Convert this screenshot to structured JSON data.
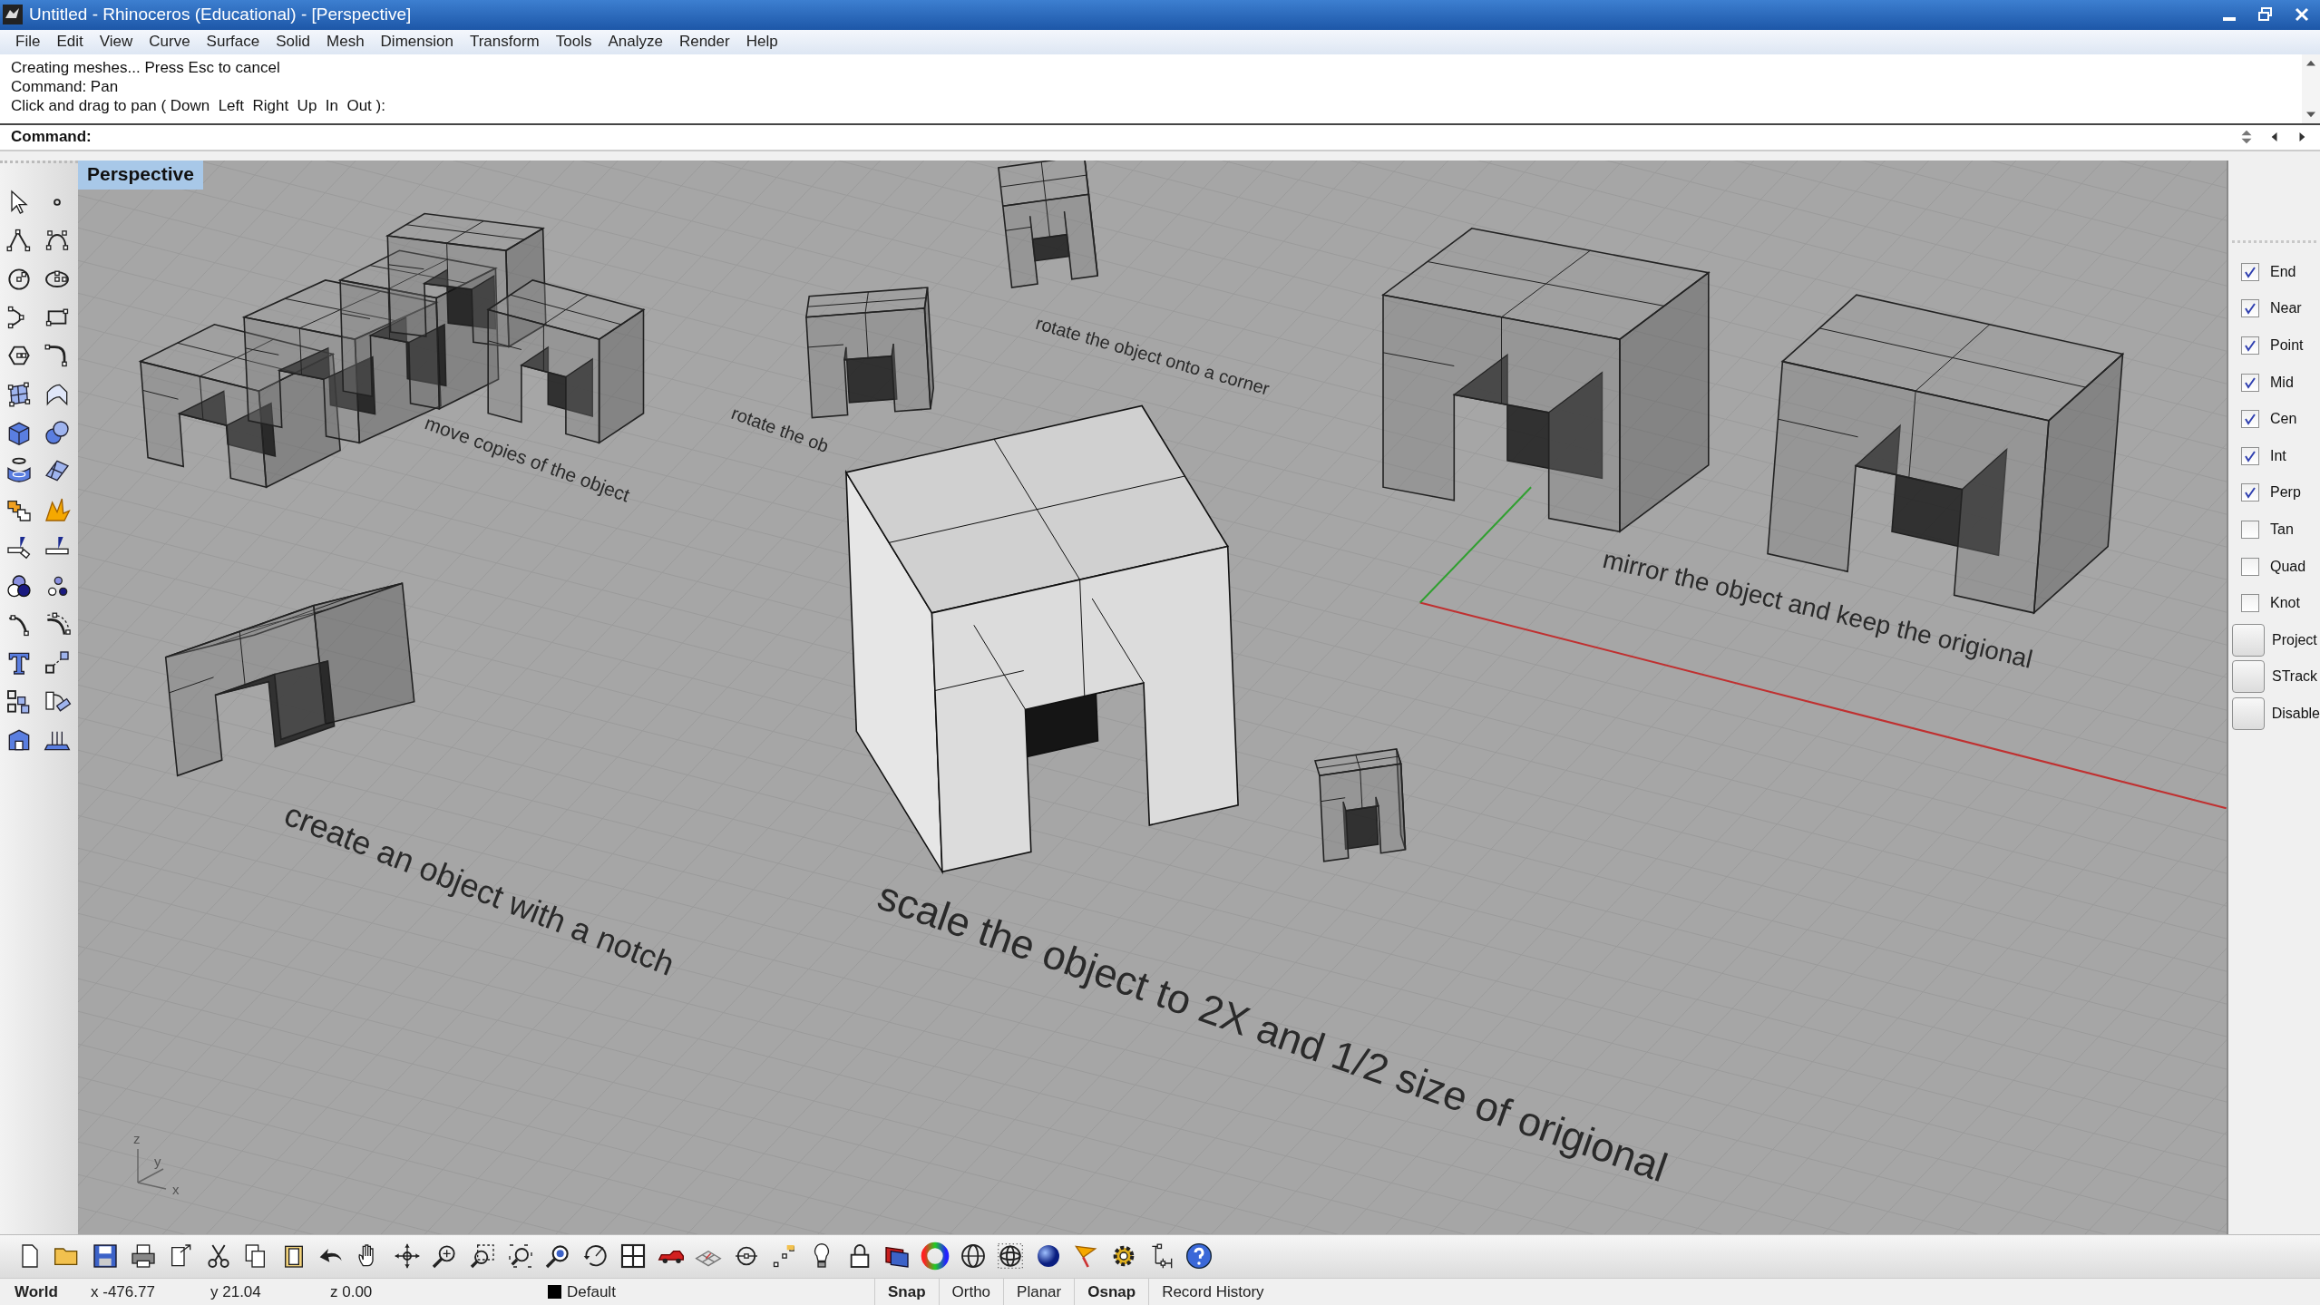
{
  "window": {
    "title": "Untitled - Rhinoceros (Educational) - [Perspective]"
  },
  "menu": [
    "File",
    "Edit",
    "View",
    "Curve",
    "Surface",
    "Solid",
    "Mesh",
    "Dimension",
    "Transform",
    "Tools",
    "Analyze",
    "Render",
    "Help"
  ],
  "command_history": [
    "Creating meshes... Press Esc to cancel",
    "Command: Pan",
    "Click and drag to pan ( Down  Left  Right  Up  In  Out ):"
  ],
  "command_prompt": {
    "label": "Command:"
  },
  "viewport": {
    "title": "Perspective",
    "annotations": [
      "move copies of the object",
      "rotate the object onto a corner",
      "rotate the ob",
      "mirror the object and keep the origional",
      "create an object with a notch",
      "scale the object to 2X and 1/2 size of origional"
    ],
    "axis_labels": [
      "z",
      "y",
      "x"
    ]
  },
  "osnaps": [
    {
      "label": "End",
      "checked": true
    },
    {
      "label": "Near",
      "checked": true
    },
    {
      "label": "Point",
      "checked": true
    },
    {
      "label": "Mid",
      "checked": true
    },
    {
      "label": "Cen",
      "checked": true
    },
    {
      "label": "Int",
      "checked": true
    },
    {
      "label": "Perp",
      "checked": true
    },
    {
      "label": "Tan",
      "checked": false
    },
    {
      "label": "Quad",
      "checked": false
    },
    {
      "label": "Knot",
      "checked": false
    }
  ],
  "osnap_toggles": [
    {
      "label": "Project",
      "on": false
    },
    {
      "label": "STrack",
      "on": false
    },
    {
      "label": "Disable",
      "on": false
    }
  ],
  "status_bar": {
    "cplane": "World",
    "x": "x -476.77",
    "y": "y 21.04",
    "z": "z 0.00",
    "layer": {
      "name": "Default",
      "color": "#000000"
    },
    "toggles": [
      {
        "label": "Snap",
        "on": true
      },
      {
        "label": "Ortho",
        "on": false
      },
      {
        "label": "Planar",
        "on": false
      },
      {
        "label": "Osnap",
        "on": true
      },
      {
        "label": "Record History",
        "on": false
      }
    ]
  }
}
